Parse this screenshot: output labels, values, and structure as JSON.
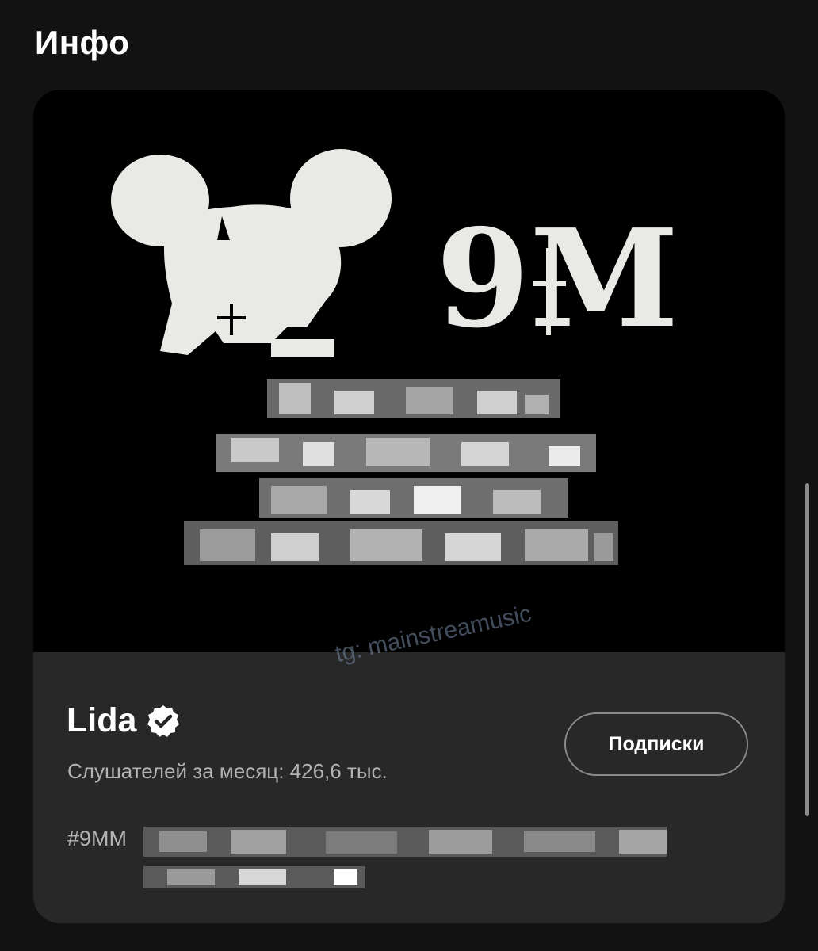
{
  "section": {
    "title": "Инфо"
  },
  "artist": {
    "name": "Lida",
    "monthly_listeners": "Слушателей за месяц: 426,6 тыс.",
    "follow_label": "Подписки",
    "bio_visible": "#9MM",
    "verified_icon": "verified-badge-icon"
  },
  "cover": {
    "logo_text": "9M"
  },
  "watermark": "tg: mainstreamusic",
  "colors": {
    "background": "#121212",
    "card": "#282828",
    "text_secondary": "#b3b3b3"
  }
}
